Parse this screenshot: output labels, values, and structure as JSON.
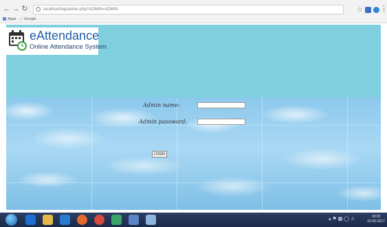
{
  "browser": {
    "url": "localhost/log/admin.php?ADMIN=ADMIN",
    "bookmarks": [
      {
        "label": "Apps",
        "icon": "apps-grid-icon"
      },
      {
        "label": "Google",
        "icon": "google-icon"
      }
    ]
  },
  "header": {
    "logo_title": "eAttendance",
    "logo_subtitle": "Online Attendance System",
    "logo_icon": "calendar-clock-icon",
    "background": "#7fcfdf"
  },
  "form": {
    "name_label": "Admin name:",
    "name_value": "",
    "password_label": "Admin password:",
    "password_value": "",
    "login_label": "LOGIN"
  },
  "taskbar": {
    "apps": [
      "windows-start-icon",
      "internet-explorer-icon",
      "file-explorer-icon",
      "media-player-icon",
      "firefox-icon",
      "chrome-icon",
      "app-icon",
      "network-icon",
      "paint-icon"
    ],
    "clock_time": "18:26",
    "clock_date": "22-06-2017"
  },
  "colors": {
    "brand_blue": "#1f5fa8",
    "header_teal": "#7fcfdf",
    "sky": "#a9d8f4"
  }
}
